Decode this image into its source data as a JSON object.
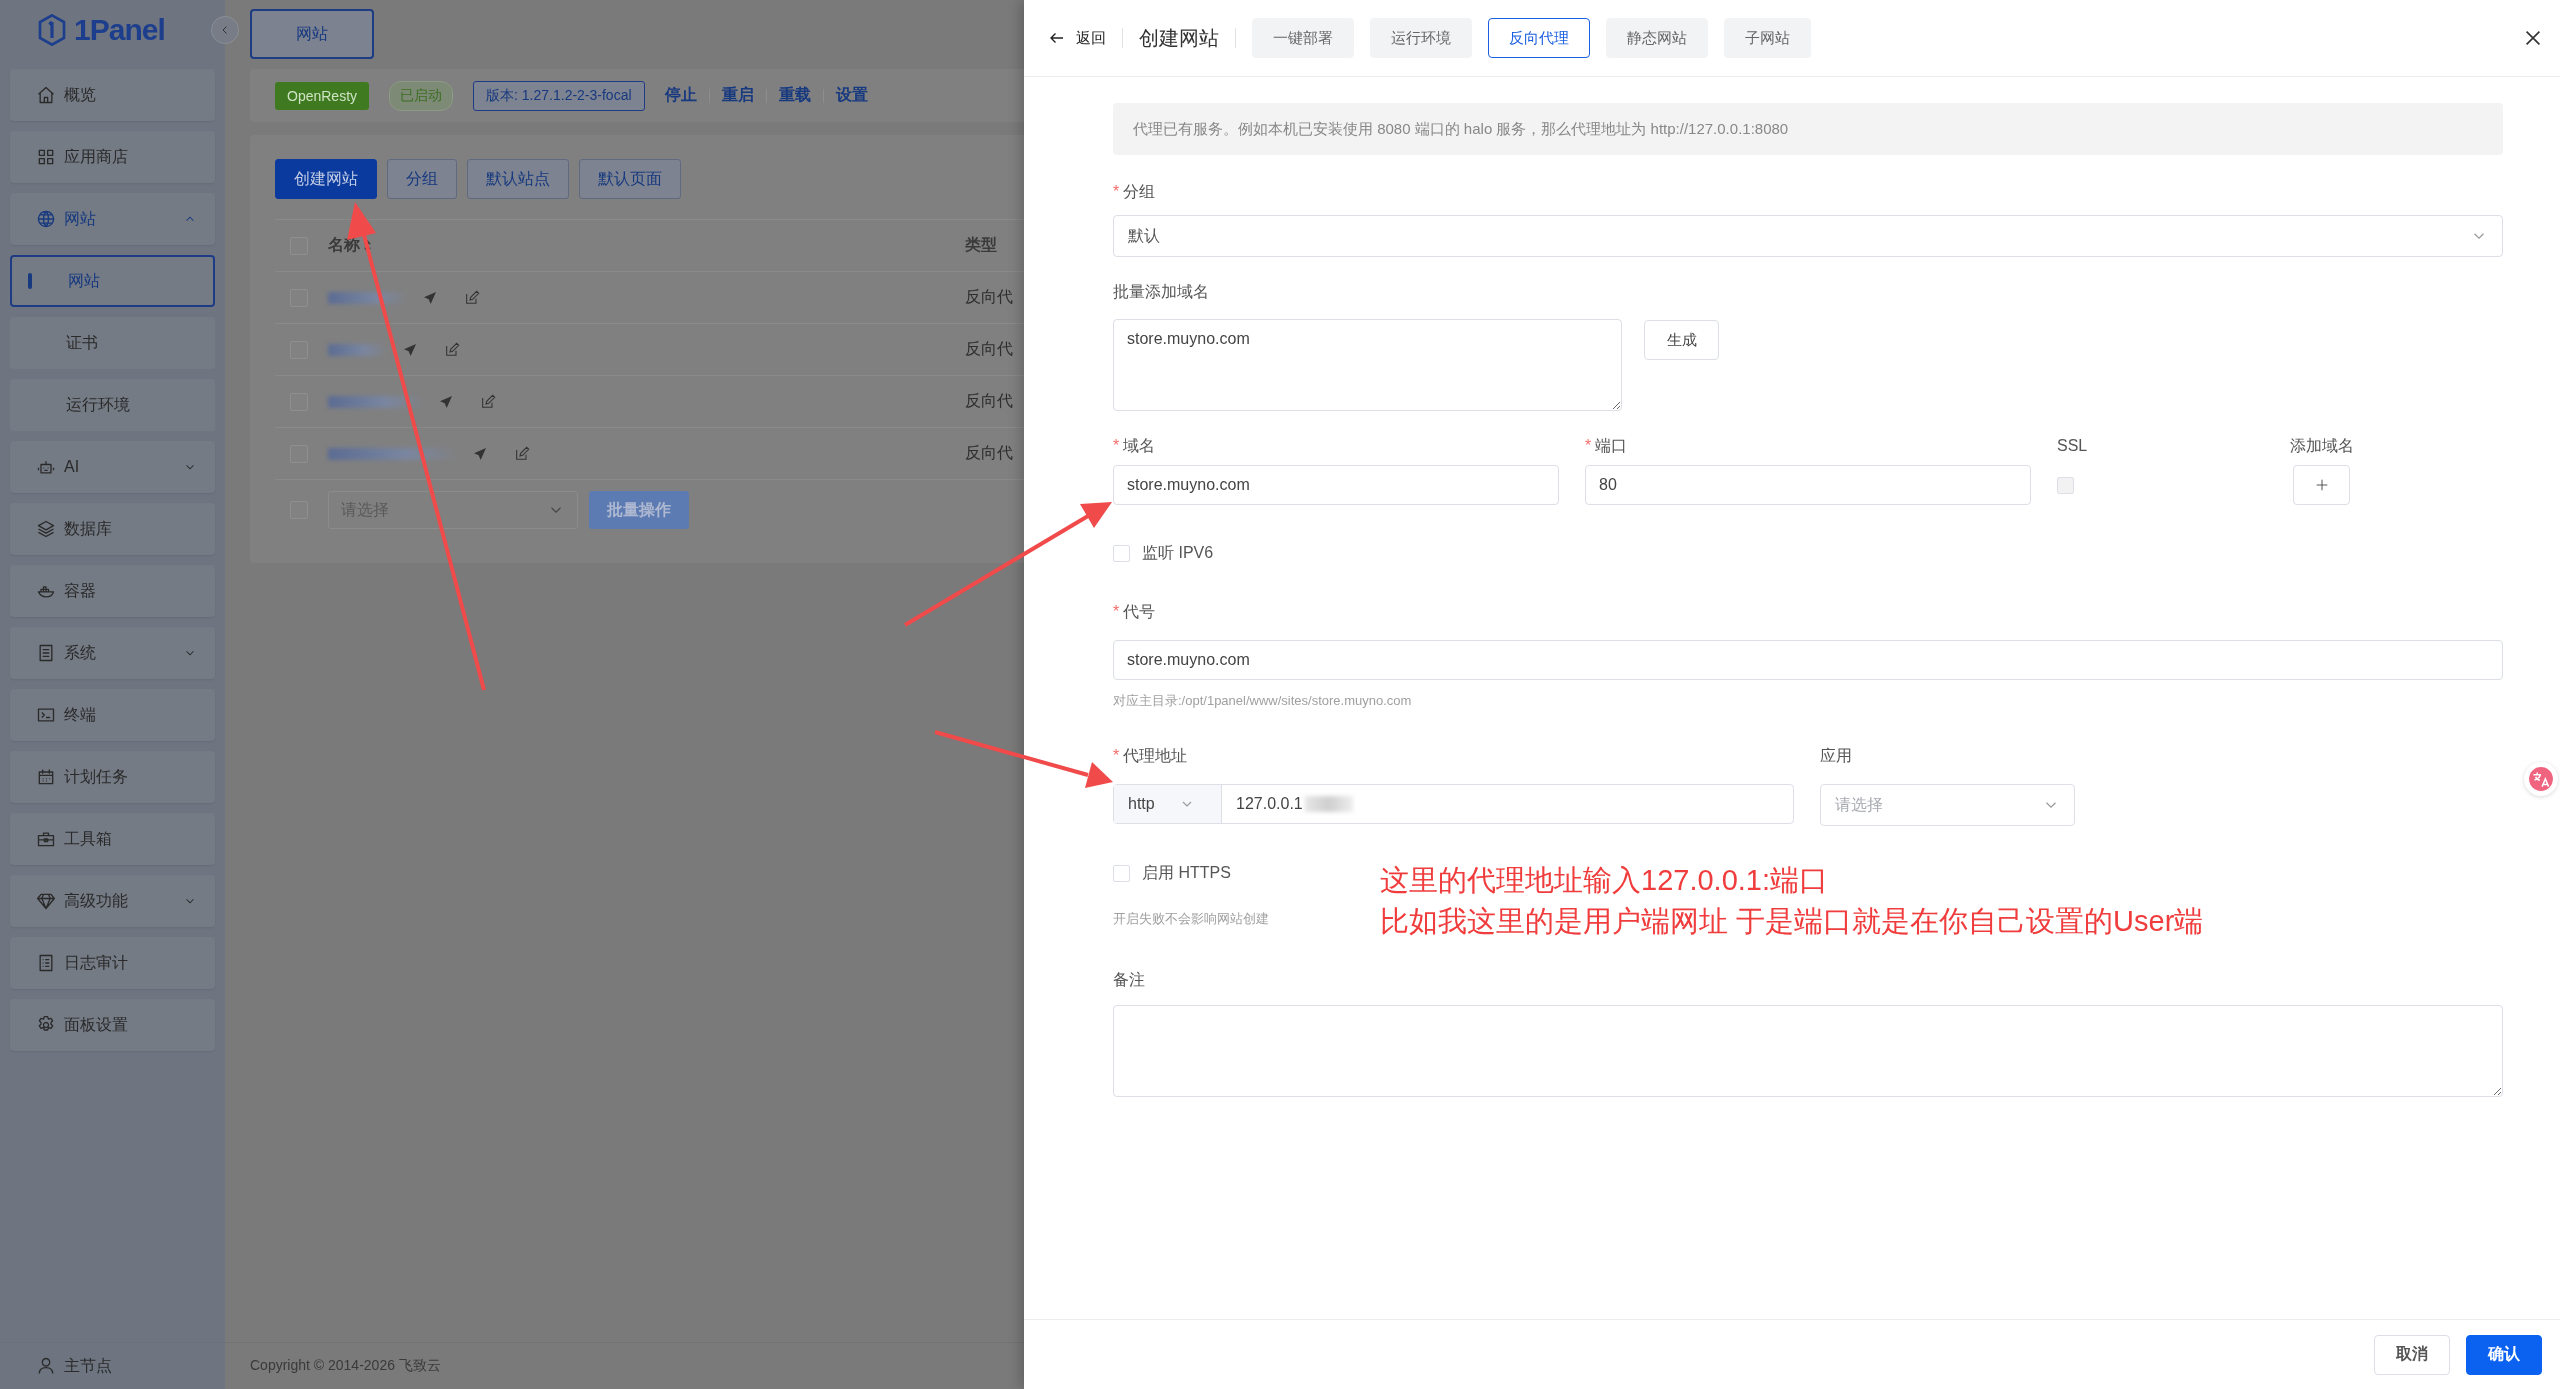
{
  "sidebar": {
    "logo": "1Panel",
    "items": [
      {
        "label": "概览",
        "kind": "link"
      },
      {
        "label": "应用商店",
        "kind": "link"
      },
      {
        "label": "网站",
        "kind": "group",
        "expanded": true,
        "children": [
          {
            "label": "网站",
            "selected": true
          },
          {
            "label": "证书",
            "selected": false
          },
          {
            "label": "运行环境",
            "selected": false
          }
        ]
      },
      {
        "label": "AI",
        "kind": "group",
        "expanded": false
      },
      {
        "label": "数据库",
        "kind": "link"
      },
      {
        "label": "容器",
        "kind": "link"
      },
      {
        "label": "系统",
        "kind": "group",
        "expanded": false
      },
      {
        "label": "终端",
        "kind": "link"
      },
      {
        "label": "计划任务",
        "kind": "link"
      },
      {
        "label": "工具箱",
        "kind": "link"
      },
      {
        "label": "高级功能",
        "kind": "group",
        "expanded": false
      },
      {
        "label": "日志审计",
        "kind": "link"
      },
      {
        "label": "面板设置",
        "kind": "link"
      }
    ],
    "node": "主节点"
  },
  "page_tab": "网站",
  "status_bar": {
    "app": "OpenResty",
    "state": "已启动",
    "version": "版本: 1.27.1.2-2-3-focal",
    "actions": [
      "停止",
      "重启",
      "重载",
      "设置"
    ]
  },
  "toolbar": [
    {
      "label": "创建网站",
      "primary": true
    },
    {
      "label": "分组",
      "primary": false
    },
    {
      "label": "默认站点",
      "primary": false
    },
    {
      "label": "默认页面",
      "primary": false
    }
  ],
  "table": {
    "columns": [
      "名称",
      "类型"
    ],
    "header_checked": false,
    "rows": [
      {
        "type": "反向代",
        "checked": false
      },
      {
        "type": "反向代",
        "checked": false
      },
      {
        "type": "反向代",
        "checked": false
      },
      {
        "type": "反向代",
        "checked": false
      }
    ],
    "batch_checked": false,
    "batch_placeholder": "请选择",
    "batch_button": "批量操作"
  },
  "copyright": "Copyright © 2014-2026 飞致云",
  "drawer": {
    "back": "返回",
    "title": "创建网站",
    "tabs": [
      {
        "label": "一键部署",
        "selected": false
      },
      {
        "label": "运行环境",
        "selected": false
      },
      {
        "label": "反向代理",
        "selected": true
      },
      {
        "label": "静态网站",
        "selected": false
      },
      {
        "label": "子网站",
        "selected": false
      }
    ],
    "required_mark": "*",
    "info": "代理已有服务。例如本机已安装使用 8080 端口的 halo 服务，那么代理地址为 http://127.0.0.1:8080",
    "group": {
      "label": "分组",
      "required": true,
      "value": "默认"
    },
    "batch_domains": {
      "label": "批量添加域名",
      "value": "store.muyno.com",
      "button": "生成"
    },
    "domain_columns": [
      {
        "label": "域名",
        "required": true
      },
      {
        "label": "端口",
        "required": true
      },
      {
        "label": "SSL",
        "required": false
      },
      {
        "label": "添加域名",
        "required": false
      }
    ],
    "domain_row": {
      "domain": "store.muyno.com",
      "port": "80",
      "ssl": false,
      "ssl_disabled": true
    },
    "ipv6": {
      "label": "监听 IPV6",
      "checked": false
    },
    "alias": {
      "label": "代号",
      "required": true,
      "value": "store.muyno.com",
      "hint": "对应主目录:/opt/1panel/www/sites/store.muyno.com"
    },
    "proxy": {
      "label": "代理地址",
      "required": true,
      "scheme": "http",
      "value": "127.0.0.1"
    },
    "app": {
      "label": "应用",
      "placeholder": "请选择"
    },
    "https": {
      "label": "启用 HTTPS",
      "checked": false,
      "hint": "开启失败不会影响网站创建"
    },
    "remark": {
      "label": "备注"
    },
    "buttons": [
      {
        "label": "取消",
        "primary": false
      },
      {
        "label": "确认",
        "primary": true
      }
    ]
  },
  "annotation": {
    "lines": [
      "这里的代理地址输入127.0.0.1:端口",
      "比如我这里的是用户端网址 于是端口就是在你自己设置的User端"
    ]
  }
}
